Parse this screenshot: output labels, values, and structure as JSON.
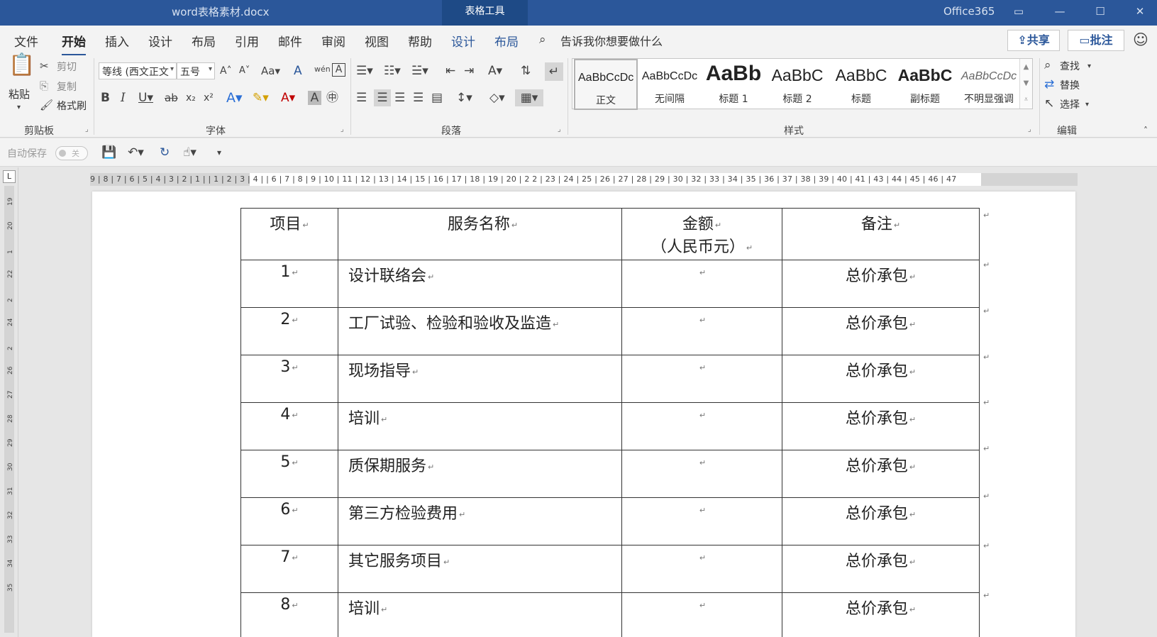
{
  "titlebar": {
    "doc_title": "word表格素材.docx",
    "context_tab": "表格工具",
    "account": "Office365"
  },
  "menu": {
    "items": [
      "文件",
      "开始",
      "插入",
      "设计",
      "布局",
      "引用",
      "邮件",
      "审阅",
      "视图",
      "帮助",
      "设计",
      "布局"
    ],
    "active_index": 1,
    "tell_me": "告诉我你想要做什么",
    "share": "共享",
    "comment": "批注"
  },
  "ribbon": {
    "clipboard": {
      "paste": "粘贴",
      "cut": "剪切",
      "copy": "复制",
      "format_painter": "格式刷",
      "label": "剪贴板"
    },
    "font": {
      "font_name": "等线 (西文正文",
      "font_size": "五号",
      "label": "字体"
    },
    "paragraph": {
      "label": "段落"
    },
    "styles": {
      "label": "样式",
      "items": [
        {
          "sample": "AaBbCcDc",
          "name": "正文"
        },
        {
          "sample": "AaBbCcDc",
          "name": "无间隔"
        },
        {
          "sample": "AaBb",
          "name": "标题 1"
        },
        {
          "sample": "AaBbC",
          "name": "标题 2"
        },
        {
          "sample": "AaBbC",
          "name": "标题"
        },
        {
          "sample": "AaBbC",
          "name": "副标题"
        },
        {
          "sample": "AaBbCcDc",
          "name": "不明显强调"
        }
      ]
    },
    "editing": {
      "find": "查找",
      "replace": "替换",
      "select": "选择",
      "label": "编辑"
    }
  },
  "qat": {
    "autosave": "自动保存",
    "autosave_state": "关"
  },
  "ruler": {
    "horizontal": "9 | 8 | 7 | 6 | 5 | 4 | 3 | 2 | 1 |   | 1 | 2 | 3 | 4 |   | 6 | 7 | 8 | 9 | 10 | 11 | 12 | 13 | 14 | 15 | 16 | 17 | 18 | 19 | 20 | 2   2 | 23 | 24 | 25 | 26 | 27 | 28 | 29 | 30   | 32 | 33 | 34 | 35 | 36 | 37 | 38 | 39 | 40 | 41   | 43 | 44 | 45 | 46 | 47",
    "vertical": [
      "19",
      "20",
      "1",
      "22",
      "2",
      "24",
      "2",
      "26",
      "27",
      "28",
      "29",
      "30",
      "31",
      "32",
      "33",
      "34",
      "35"
    ]
  },
  "table": {
    "headers": [
      {
        "lines": [
          "项目"
        ]
      },
      {
        "lines": [
          "服务名称"
        ]
      },
      {
        "lines": [
          "金额",
          "（人民币元）"
        ]
      },
      {
        "lines": [
          "备注"
        ]
      }
    ],
    "rows": [
      {
        "no": "1",
        "name": "设计联络会",
        "amount": "",
        "note": "总价承包"
      },
      {
        "no": "2",
        "name": "工厂试验、检验和验收及监造",
        "amount": "",
        "note": "总价承包"
      },
      {
        "no": "3",
        "name": "现场指导",
        "amount": "",
        "note": "总价承包"
      },
      {
        "no": "4",
        "name": "培训",
        "amount": "",
        "note": "总价承包"
      },
      {
        "no": "5",
        "name": "质保期服务",
        "amount": "",
        "note": "总价承包"
      },
      {
        "no": "6",
        "name": "第三方检验费用",
        "amount": "",
        "note": "总价承包"
      },
      {
        "no": "7",
        "name": "其它服务项目",
        "amount": "",
        "note": "总价承包"
      },
      {
        "no": "8",
        "name": "培训",
        "amount": "",
        "note": "总价承包"
      }
    ],
    "paragraph_mark": "↵"
  },
  "colors": {
    "brand": "#2b579a",
    "context_tab": "#1e4a86"
  }
}
